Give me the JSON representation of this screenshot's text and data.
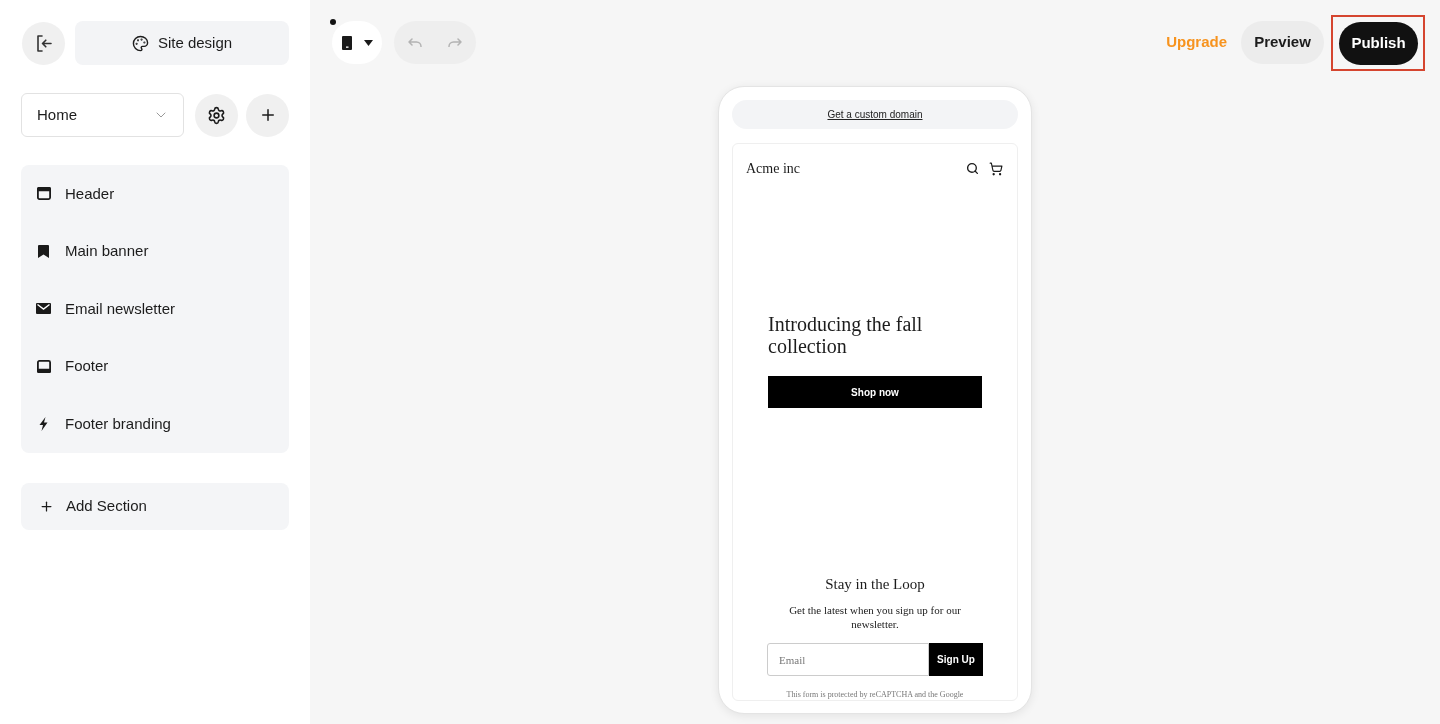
{
  "sidebar": {
    "site_design_button": "Site design",
    "page_select": {
      "value": "Home"
    },
    "sections": [
      {
        "label": "Header",
        "kind": "header"
      },
      {
        "label": "Main banner",
        "kind": "banner"
      },
      {
        "label": "Email newsletter",
        "kind": "newsletter"
      },
      {
        "label": "Footer",
        "kind": "footer"
      },
      {
        "label": "Footer branding",
        "kind": "branding"
      }
    ],
    "add_section_button": "Add Section"
  },
  "toolbar": {
    "device_switcher": {
      "badge": true
    },
    "undo": {
      "disabled": true
    },
    "redo": {
      "disabled": true
    },
    "upgrade_link": "Upgrade",
    "preview_button": "Preview",
    "publish_button": {
      "label": "Publish",
      "highlighted": true
    }
  },
  "preview": {
    "domain_banner": "Get a custom domain",
    "brand": "Acme inc",
    "hero": {
      "title": "Introducing the fall collection",
      "button": "Shop now"
    },
    "newsletter": {
      "title": "Stay in the Loop",
      "text": "Get the latest when you sign up for our newsletter.",
      "email": {
        "placeholder": "Email"
      },
      "button": "Sign Up",
      "notice": "This form is protected by reCAPTCHA and the Google"
    }
  }
}
